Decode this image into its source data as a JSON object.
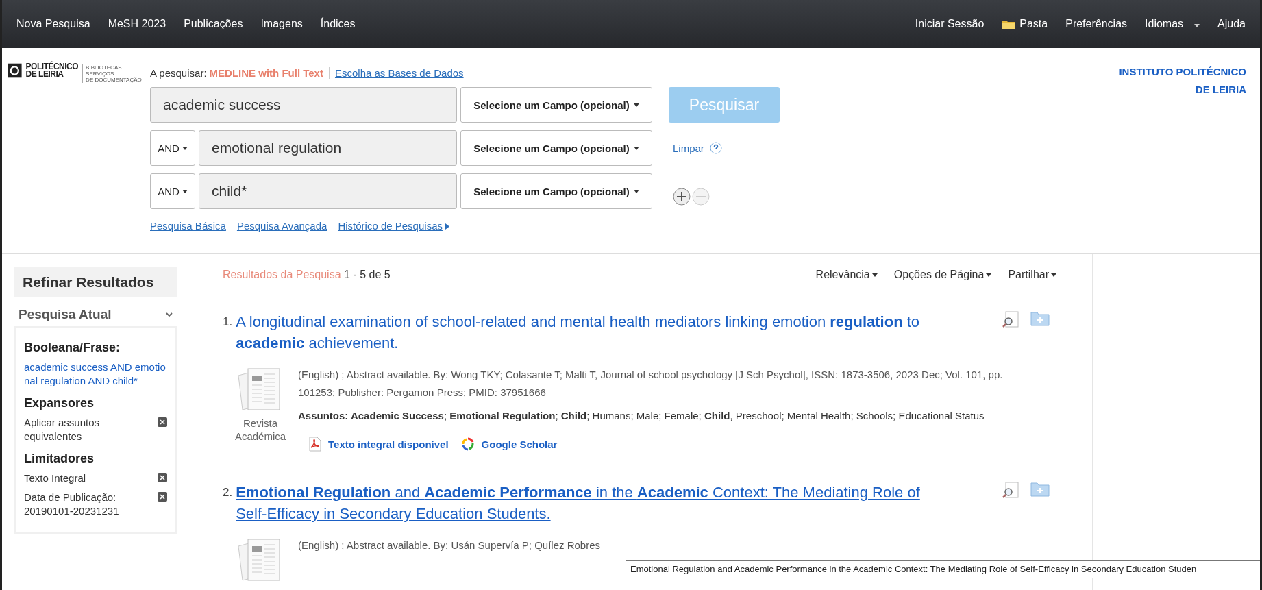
{
  "top_nav": {
    "left": [
      {
        "label": "Nova Pesquisa"
      },
      {
        "label": "MeSH 2023"
      },
      {
        "label": "Publicações"
      },
      {
        "label": "Imagens"
      },
      {
        "label": "Índices"
      }
    ],
    "right": [
      {
        "label": "Iniciar Sessão",
        "kind": "plain"
      },
      {
        "label": "Pasta",
        "kind": "folder"
      },
      {
        "label": "Preferências",
        "kind": "plain"
      },
      {
        "label": "Idiomas",
        "kind": "dropdown"
      },
      {
        "label": "Ajuda",
        "kind": "plain"
      }
    ]
  },
  "logo": {
    "line_1": "POLITÉCNICO",
    "line_2": "DE LEIRIA",
    "tagline_1": "BIBLIOTECAS . SERVIÇOS",
    "tagline_2": "DE DOCUMENTAÇÃO"
  },
  "institution": "INSTITUTO POLITÉCNICO DE LEIRIA",
  "search": {
    "searching_label": "A pesquisar:",
    "database": "MEDLINE with Full Text",
    "choose_databases": "Escolha as Bases de Dados",
    "rows": [
      {
        "value": "academic success",
        "field": "Selecione um Campo (opcional)"
      },
      {
        "operator": "AND",
        "value": "emotional regulation",
        "field": "Selecione um Campo (opcional)"
      },
      {
        "operator": "AND",
        "value": "child*",
        "field": "Selecione um Campo (opcional)"
      }
    ],
    "search_button": "Pesquisar",
    "clear": "Limpar",
    "links": [
      {
        "label": "Pesquisa Básica",
        "kind": "plain"
      },
      {
        "label": "Pesquisa Avançada",
        "kind": "plain"
      },
      {
        "label": "Histórico de Pesquisas",
        "kind": "expand"
      }
    ]
  },
  "sidebar": {
    "title": "Refinar Resultados",
    "section": "Pesquisa Atual",
    "expanded": true,
    "groups": [
      {
        "heading": "Booleana/Frase:",
        "items": [
          {
            "text": "academic success AND emotional regulation AND child*",
            "kind": "query"
          }
        ]
      },
      {
        "heading": "Expansores",
        "items": [
          {
            "text": "Aplicar assuntos equivalentes",
            "kind": "removable"
          }
        ]
      },
      {
        "heading": "Limitadores",
        "items": [
          {
            "text": "Texto Integral",
            "kind": "removable"
          },
          {
            "text": "Data de Publicação: 20190101-20231231",
            "kind": "removable"
          }
        ]
      }
    ]
  },
  "results": {
    "label": "Resultados da Pesquisa",
    "range": "1 - 5 de 5",
    "sort": [
      {
        "label": "Relevância"
      },
      {
        "label": "Opções de Página"
      },
      {
        "label": "Partilhar"
      }
    ],
    "items": [
      {
        "number": "1.",
        "title": "A longitudinal examination of school-related and mental health mediators linking emotion **regulation** to **academic** achievement.",
        "hovered": false,
        "type": "Revista Académica",
        "details": "(English) ; Abstract available. By: Wong TKY; Colasante T; Malti T, Journal of school psychology [J Sch Psychol], ISSN: 1873-3506, 2023 Dec; Vol. 101, pp. 101253; Publisher: Pergamon Press; PMID: 37951666",
        "subjects": "**Assuntos: Academic Success**; **Emotional Regulation**; **Child**; Humans; Male; Female; **Child**, Preschool; Mental Health; Schools; Educational Status",
        "links": [
          {
            "label": "Texto integral disponível",
            "kind": "pdf"
          },
          {
            "label": "Google Scholar",
            "kind": "scholar"
          }
        ]
      },
      {
        "number": "2.",
        "title": "**Emotional Regulation** and **Academic Performance** in the **Academic** Context: The Mediating Role of Self-Efficacy in Secondary Education Students.",
        "hovered": true,
        "details": "(English) ; Abstract available. By: Usán Supervía P; Quílez Robres"
      }
    ]
  },
  "tooltip": "Emotional Regulation and Academic Performance in the Academic Context: The Mediating Role of Self-Efficacy in Secondary Education Studen"
}
